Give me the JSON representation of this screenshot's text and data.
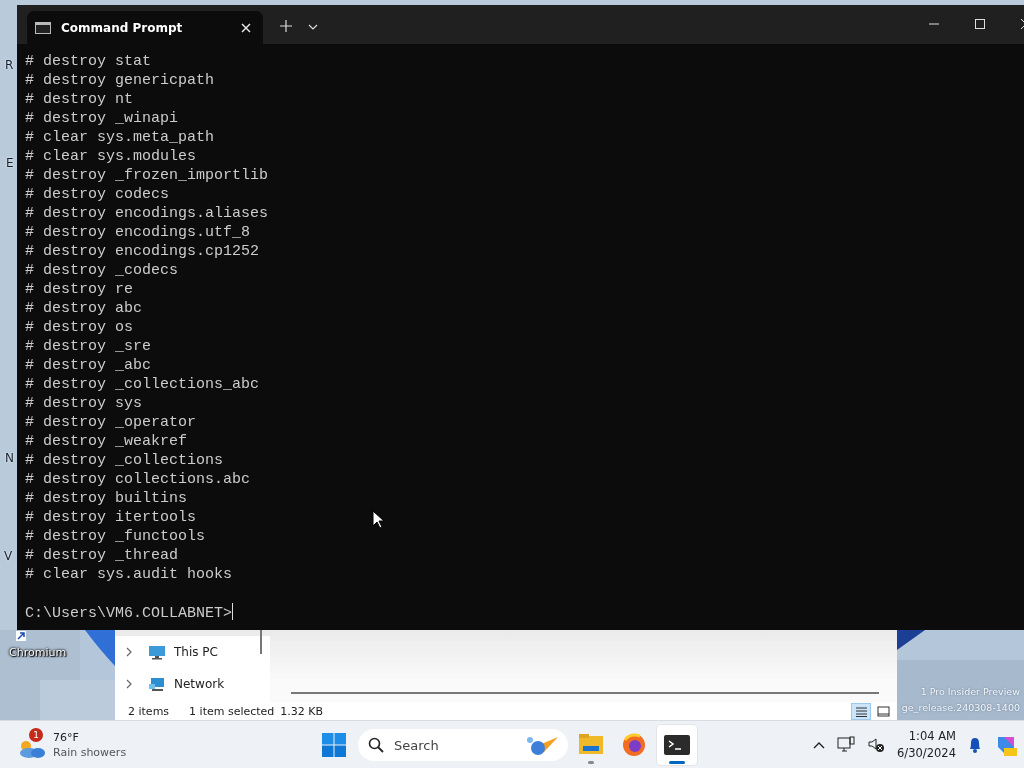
{
  "desktop": {
    "icons": [
      {
        "label": "R"
      },
      {
        "label": "E"
      },
      {
        "label": "N"
      },
      {
        "label": "V"
      },
      {
        "label": "Chromium"
      }
    ],
    "watermark": [
      "1 Pro Insider Preview",
      "ge_release.240308-1400"
    ]
  },
  "terminal": {
    "tabs": [
      {
        "title": "Command Prompt",
        "selected": true
      }
    ],
    "lines": [
      "# destroy stat",
      "# destroy genericpath",
      "# destroy nt",
      "# destroy _winapi",
      "# clear sys.meta_path",
      "# clear sys.modules",
      "# destroy _frozen_importlib",
      "# destroy codecs",
      "# destroy encodings.aliases",
      "# destroy encodings.utf_8",
      "# destroy encodings.cp1252",
      "# destroy _codecs",
      "# destroy re",
      "# destroy abc",
      "# destroy os",
      "# destroy _sre",
      "# destroy _abc",
      "# destroy _collections_abc",
      "# destroy sys",
      "# destroy _operator",
      "# destroy _weakref",
      "# destroy _collections",
      "# destroy collections.abc",
      "# destroy builtins",
      "# destroy itertools",
      "# destroy _functools",
      "# destroy _thread",
      "# clear sys.audit hooks"
    ],
    "prompt": "C:\\Users\\VM6.COLLABNET>"
  },
  "explorer": {
    "nav": [
      {
        "label": "This PC",
        "kind": "pc"
      },
      {
        "label": "Network",
        "kind": "network"
      }
    ],
    "status": [
      "2 items",
      "1 item selected",
      "1.32 KB"
    ],
    "views": [
      {
        "kind": "details",
        "selected": true
      },
      {
        "kind": "tiles",
        "selected": false
      }
    ]
  },
  "taskbar": {
    "weather": {
      "badge": "1",
      "temperature": "76°F",
      "condition": "Rain showers"
    },
    "search": {
      "placeholder": "Search"
    },
    "apps": [
      {
        "kind": "explorer",
        "running": true,
        "selected": false
      },
      {
        "kind": "firefox",
        "running": false,
        "selected": false
      },
      {
        "kind": "terminal",
        "running": true,
        "selected": true
      }
    ],
    "clock": {
      "time": "1:04 AM",
      "date": "6/30/2024"
    }
  }
}
